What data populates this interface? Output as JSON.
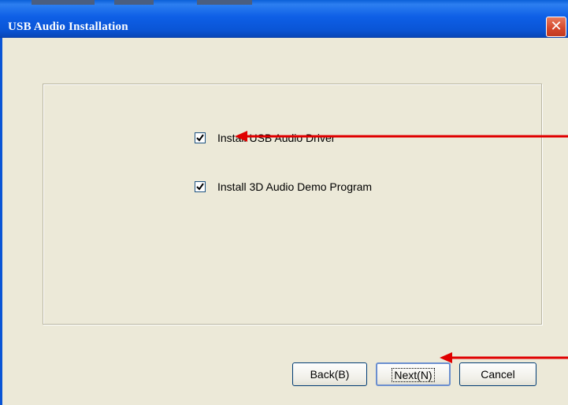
{
  "window": {
    "title": "USB Audio Installation",
    "close_icon": "close-icon",
    "accent": "#0a55d6",
    "close_color": "#d4462a"
  },
  "options": [
    {
      "label": "Install USB Audio Driver",
      "checked": true
    },
    {
      "label": "Install 3D Audio Demo Program",
      "checked": true
    }
  ],
  "buttons": {
    "back_label": "Back(B)",
    "next_label": "Next(N)",
    "cancel_label": "Cancel"
  },
  "annotation": {
    "arrow_color": "#e00000"
  }
}
